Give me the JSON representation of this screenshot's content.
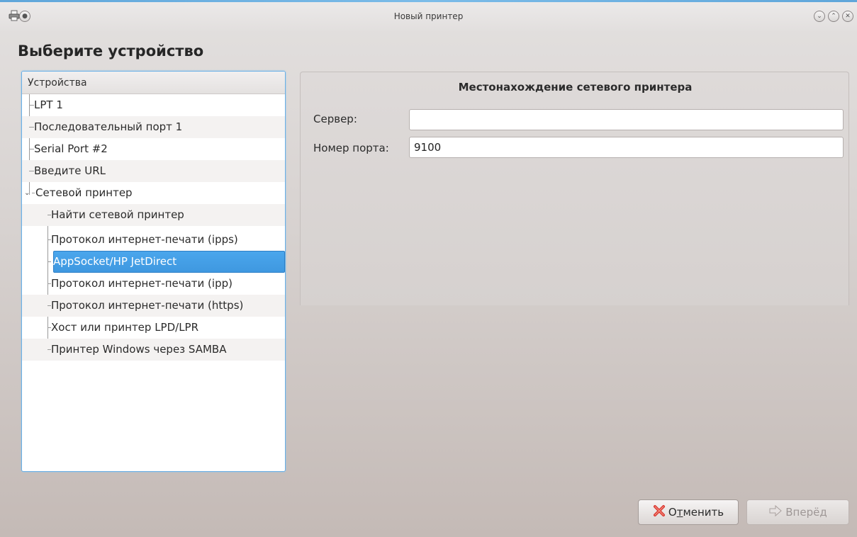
{
  "window": {
    "title": "Новый принтер",
    "icons": [
      "printer-icon",
      "sticky-icon",
      "minimize-icon",
      "maximize-icon",
      "close-icon"
    ]
  },
  "page": {
    "heading": "Выберите устройство"
  },
  "device_tree": {
    "header": "Устройства",
    "items": [
      {
        "label": "LPT 1",
        "level": 0
      },
      {
        "label": "Последовательный порт 1",
        "level": 0
      },
      {
        "label": "Serial Port #2",
        "level": 0
      },
      {
        "label": "Введите URL",
        "level": 0
      },
      {
        "label": "Сетевой принтер",
        "level": 0,
        "expanded": true
      },
      {
        "label": "Найти сетевой принтер",
        "level": 1
      },
      {
        "label": "Протокол интернет-печати (ipps)",
        "level": 1
      },
      {
        "label": "AppSocket/HP JetDirect",
        "level": 1,
        "selected": true
      },
      {
        "label": "Протокол интернет-печати (ipp)",
        "level": 1
      },
      {
        "label": "Протокол интернет-печати (https)",
        "level": 1
      },
      {
        "label": "Хост или принтер LPD/LPR",
        "level": 1
      },
      {
        "label": "Принтер Windows через SAMBA",
        "level": 1
      }
    ]
  },
  "details": {
    "title": "Местонахождение сетевого принтера",
    "server": {
      "label": "Сервер:",
      "value": ""
    },
    "port": {
      "label": "Номер порта:",
      "value": "9100"
    }
  },
  "buttons": {
    "cancel": {
      "label_pre": "О",
      "label_mnemonic": "т",
      "label_post": "менить"
    },
    "forward": {
      "label": "Вперёд",
      "disabled": true
    }
  },
  "colors": {
    "selection": "#3f98e0",
    "focus_border": "#6ab0e6",
    "cancel_icon": "#d9332c"
  }
}
